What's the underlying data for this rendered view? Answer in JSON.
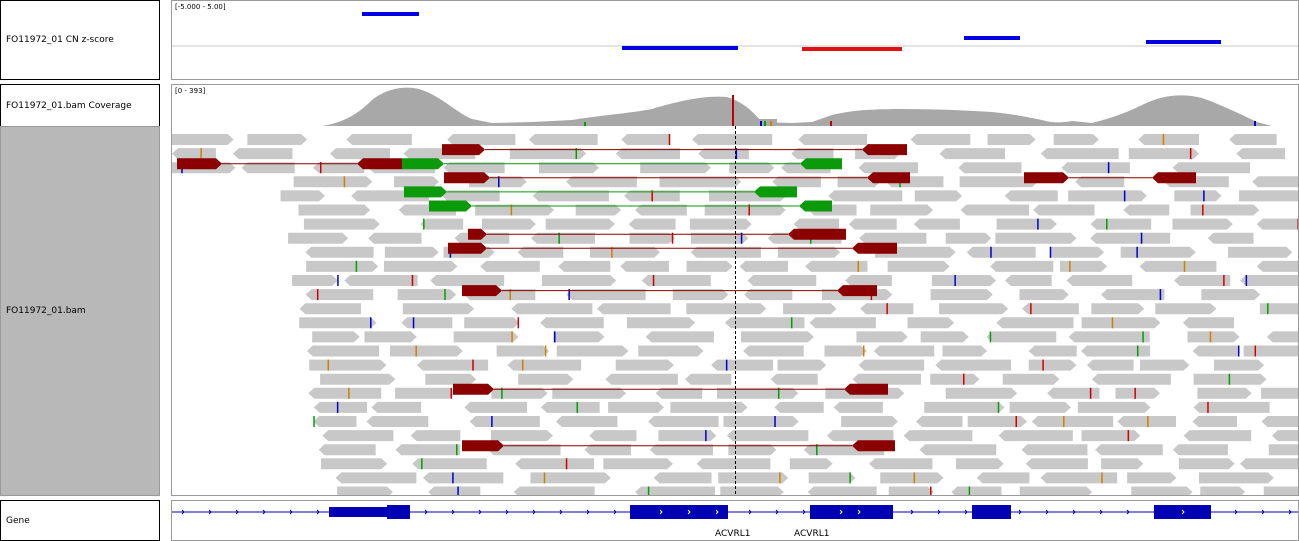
{
  "tracks": {
    "cn": {
      "name": "FO11972_01 CN z-score",
      "range": "[-5.000 - 5.00]"
    },
    "coverage": {
      "name": "FO11972_01.bam Coverage",
      "range": "[0 - 393]"
    },
    "bam": {
      "name": "FO11972_01.bam"
    },
    "gene": {
      "name": "Gene",
      "labels": [
        "ACVRL1",
        "ACVRL1"
      ]
    }
  },
  "colors": {
    "gain_segment": "#0000e0",
    "loss_segment": "#e01010",
    "read": "#c8c8c8",
    "discordant_red": "#8b0000",
    "discordant_green": "#0a9a0a",
    "discordant_blue": "#00008b",
    "gene": "#0000b4"
  }
}
